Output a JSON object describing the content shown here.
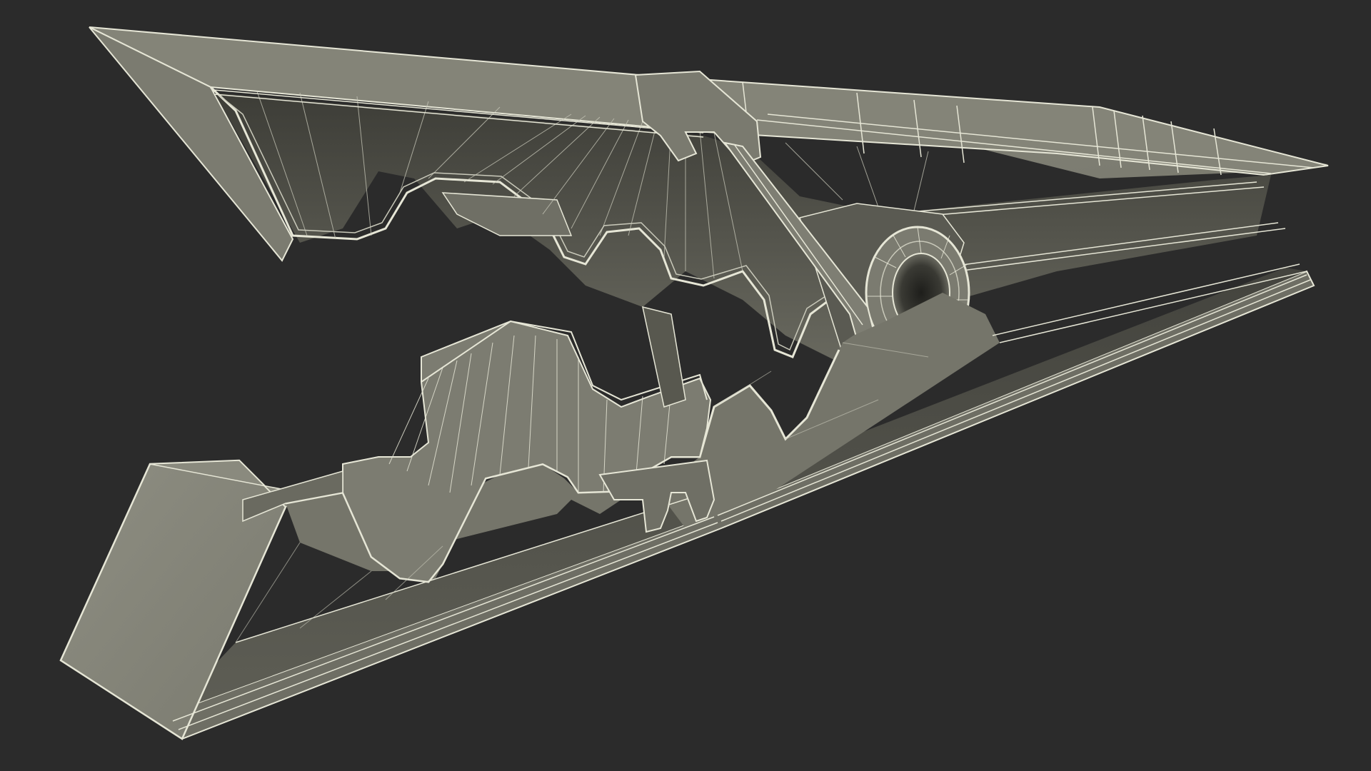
{
  "scene": {
    "background_color": "#2b2b2b",
    "subject": "clothespin-wireframe-render",
    "colors": {
      "surface_light": "#8a8a7e",
      "surface_mid": "#75756a",
      "surface_dark": "#4e4e47",
      "surface_shadow": "#3a3a35",
      "wire": "#e6e6d6",
      "wire_faint": "#c9c9ba"
    }
  }
}
